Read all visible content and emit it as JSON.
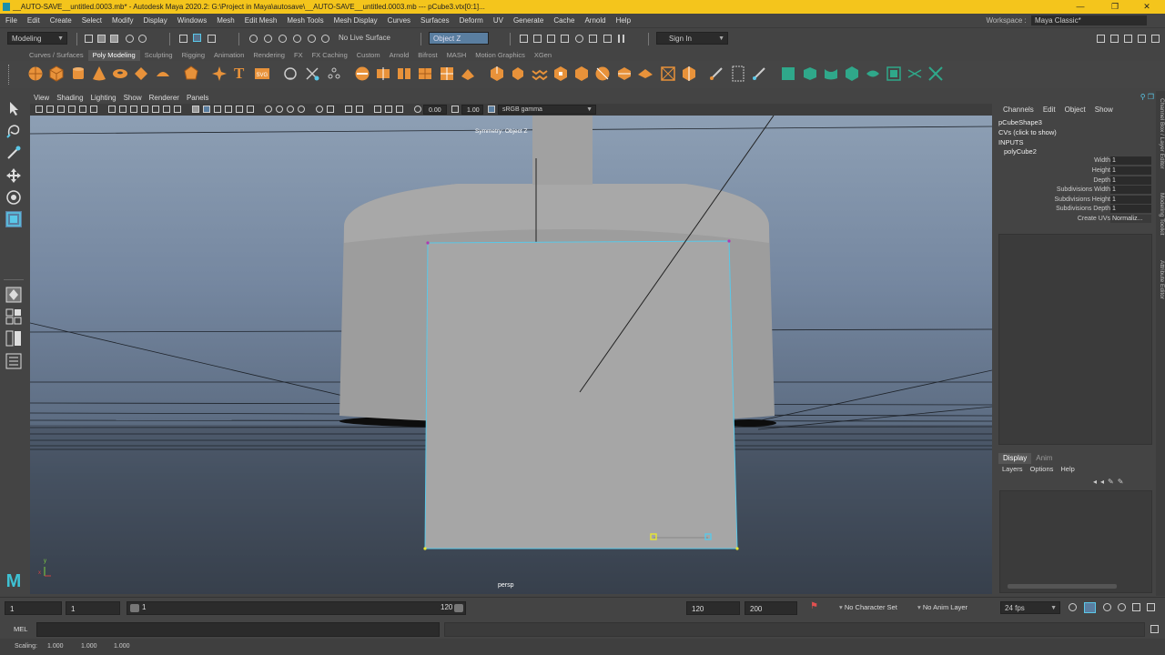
{
  "window": {
    "title": "__AUTO-SAVE__untitled.0003.mb* - Autodesk Maya 2020.2: G:\\Project in Maya\\autosave\\__AUTO-SAVE__untitled.0003.mb  ---  pCube3.vtx[0:1]...",
    "minimize": "—",
    "restore": "❐",
    "close": "✕"
  },
  "menubar": {
    "items": [
      "File",
      "Edit",
      "Create",
      "Select",
      "Modify",
      "Display",
      "Windows",
      "Mesh",
      "Edit Mesh",
      "Mesh Tools",
      "Mesh Display",
      "Curves",
      "Surfaces",
      "Deform",
      "UV",
      "Generate",
      "Cache",
      "Arnold",
      "Help"
    ],
    "workspace_label": "Workspace :",
    "workspace_value": "Maya Classic*"
  },
  "statusline": {
    "menuset": "Modeling",
    "live_surface": "No Live Surface",
    "symmetry": "Object Z",
    "signin": "Sign In"
  },
  "shelf": {
    "tabs": [
      "Curves / Surfaces",
      "Poly Modeling",
      "Sculpting",
      "Rigging",
      "Animation",
      "Rendering",
      "FX",
      "FX Caching",
      "Custom",
      "Arnold",
      "Bifrost",
      "MASH",
      "Motion Graphics",
      "XGen"
    ],
    "active_tab": "Poly Modeling"
  },
  "viewport": {
    "menus": [
      "View",
      "Shading",
      "Lighting",
      "Show",
      "Renderer",
      "Panels"
    ],
    "exposure": "0.00",
    "gamma": "1.00",
    "colorspace": "sRGB gamma",
    "symmetry_hud": "Symmetry: Object Z",
    "camera": "persp",
    "axis_y": "y",
    "axis_x": "x"
  },
  "channel_box": {
    "menus": [
      "Channels",
      "Edit",
      "Object",
      "Show"
    ],
    "shape_name": "pCubeShape3",
    "cvs_hint": "CVs (click to show)",
    "inputs_label": "INPUTS",
    "input_node": "polyCube2",
    "attributes": [
      {
        "label": "Width",
        "value": "1"
      },
      {
        "label": "Height",
        "value": "1"
      },
      {
        "label": "Depth",
        "value": "1"
      },
      {
        "label": "Subdivisions Width",
        "value": "1"
      },
      {
        "label": "Subdivisions Height",
        "value": "1"
      },
      {
        "label": "Subdivisions Depth",
        "value": "1"
      },
      {
        "label": "Create UVs",
        "value": "Normaliz..."
      }
    ],
    "side_tabs": [
      "Channel Box / Layer Editor",
      "Modeling Toolkit",
      "Attribute Editor"
    ]
  },
  "layer_editor": {
    "tabs": [
      "Display",
      "Anim"
    ],
    "menus": [
      "Layers",
      "Options",
      "Help"
    ]
  },
  "timebar": {
    "start": "1",
    "current": "1",
    "range_start": "1",
    "range_end": "120",
    "end": "120",
    "end_max": "200",
    "character_set": "No Character Set",
    "anim_layer": "No Anim Layer",
    "fps": "24 fps"
  },
  "cmdline": {
    "label": "MEL"
  },
  "helpline": {
    "scaling_label": "Scaling:",
    "values": [
      "1.000",
      "1.000",
      "1.000"
    ]
  },
  "colors": {
    "maya_title_yellow": "#f4c51c",
    "accent_cyan": "#5ac8e8",
    "shelf_orange": "#e8923a",
    "shelf_green": "#2fa88a"
  }
}
